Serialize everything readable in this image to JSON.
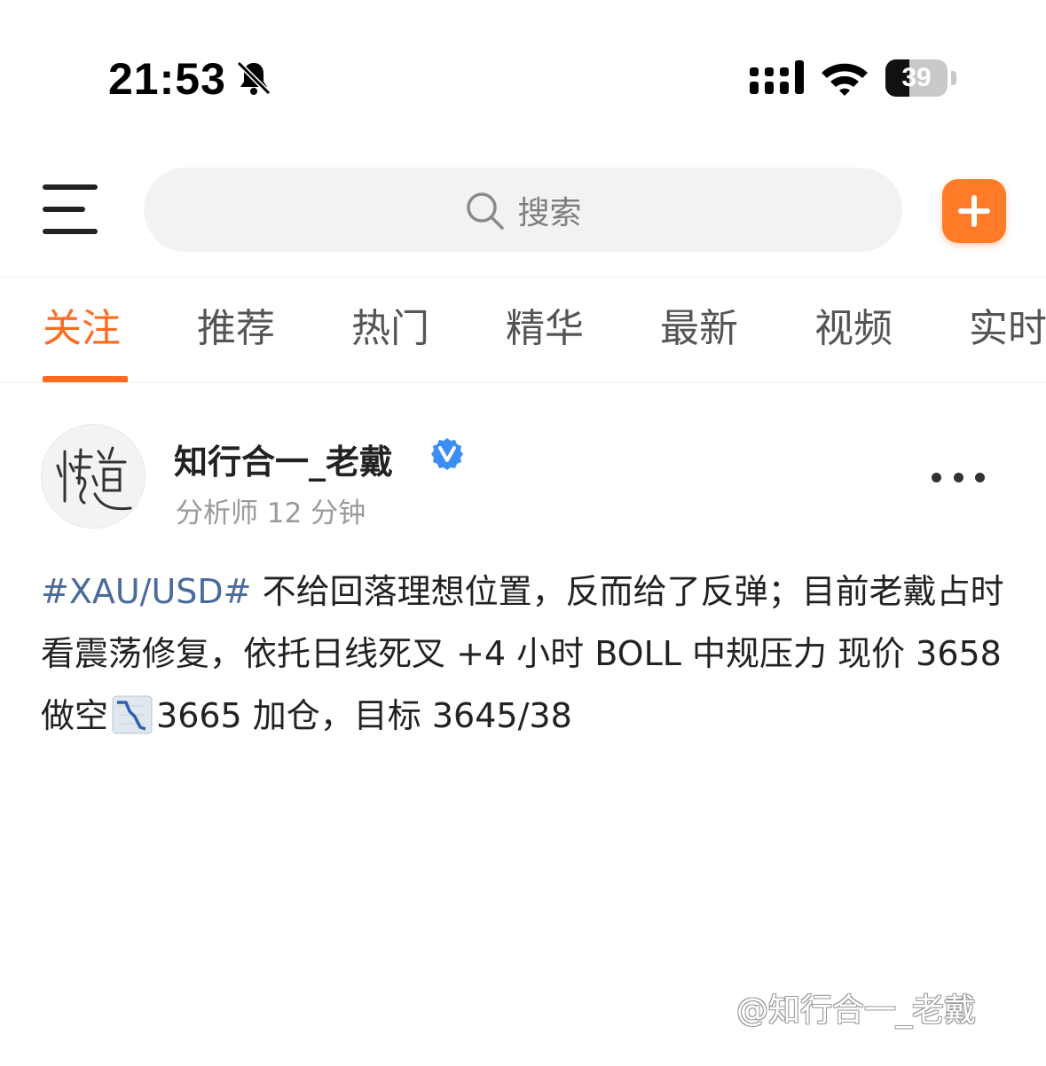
{
  "status_bar": {
    "time": "21:53",
    "battery": "39",
    "battery_level_percent": 39,
    "icons": [
      "bell-slash-icon",
      "cellular-signal-icon",
      "wifi-icon",
      "battery-icon"
    ]
  },
  "top_bar": {
    "menu_icon": "hamburger-menu-icon",
    "search_placeholder": "搜索",
    "add_icon": "plus-icon",
    "accent_color": "#ff7b28"
  },
  "tabs": {
    "items": [
      {
        "label": "关注",
        "active": true
      },
      {
        "label": "推荐",
        "active": false
      },
      {
        "label": "热门",
        "active": false
      },
      {
        "label": "精华",
        "active": false
      },
      {
        "label": "最新",
        "active": false
      },
      {
        "label": "视频",
        "active": false
      },
      {
        "label": "实时",
        "active": false
      }
    ],
    "active_color": "#ff6a1f"
  },
  "post": {
    "author": {
      "name": "知行合一_老戴",
      "verified_icon": "verified-v-badge-icon",
      "meta": "分析师 12 分钟",
      "avatar_text": "悟道"
    },
    "more_icon": "more-dots-icon",
    "hashtag": "#XAU/USD#",
    "text_part1": " 不给回落理想位置，反而给了反弹；目前老戴占时看震荡修复，依托日线死叉 +4 小时 BOLL 中规压力 现价 3658 做空",
    "emoji_icon": "chart-decreasing-icon",
    "text_part2": "3665 加仓，目标 3645/38",
    "link_color": "#4a6b9c"
  },
  "watermark": "@知行合一_老戴"
}
